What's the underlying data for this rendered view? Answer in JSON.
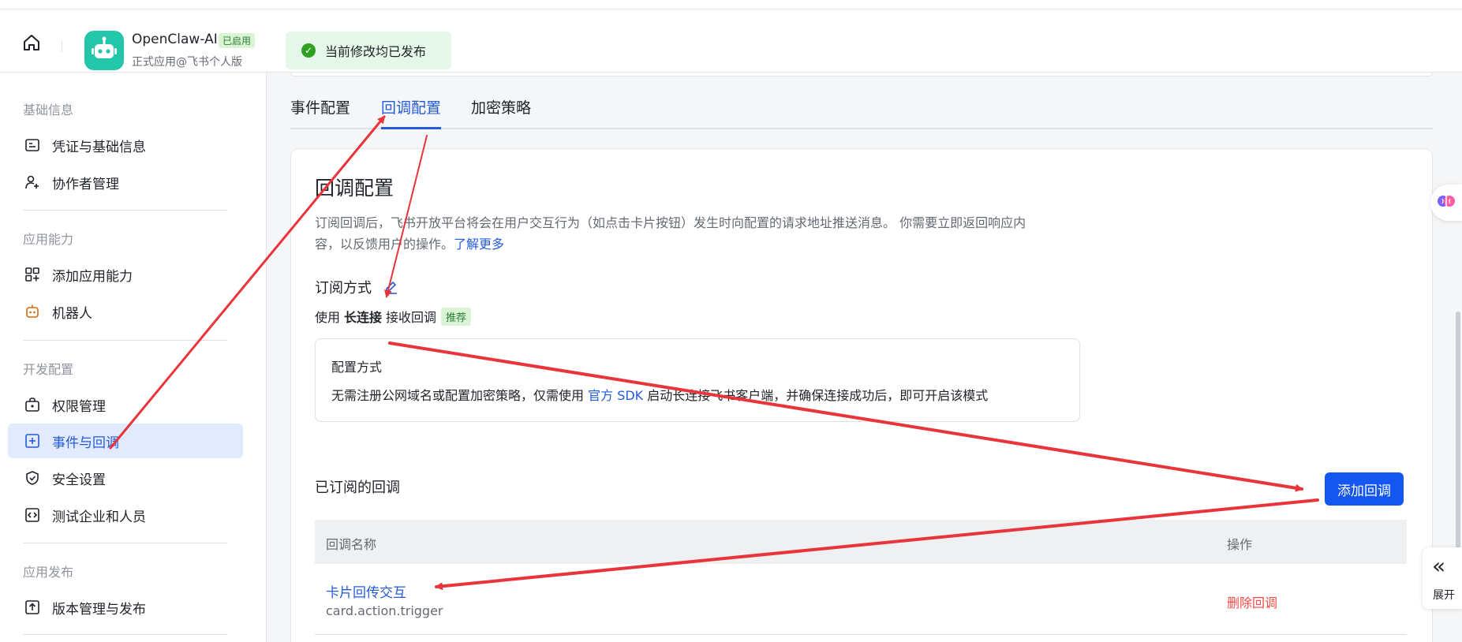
{
  "header": {
    "app_name": "OpenClaw-AI",
    "app_badge": "已启用",
    "app_sub": "正式应用@飞书个人版",
    "publish_status": "当前修改均已发布"
  },
  "sidebar": {
    "sections": [
      {
        "title": "基础信息",
        "items": [
          {
            "label": "凭证与基础信息",
            "icon": "credential-icon"
          },
          {
            "label": "协作者管理",
            "icon": "user-add-icon"
          }
        ]
      },
      {
        "title": "应用能力",
        "items": [
          {
            "label": "添加应用能力",
            "icon": "apps-add-icon"
          },
          {
            "label": "机器人",
            "icon": "robot-icon"
          }
        ]
      },
      {
        "title": "开发配置",
        "items": [
          {
            "label": "权限管理",
            "icon": "lock-bag-icon"
          },
          {
            "label": "事件与回调",
            "icon": "event-icon"
          },
          {
            "label": "安全设置",
            "icon": "shield-icon"
          },
          {
            "label": "测试企业和人员",
            "icon": "code-icon"
          }
        ]
      },
      {
        "title": "应用发布",
        "items": [
          {
            "label": "版本管理与发布",
            "icon": "upload-icon"
          }
        ]
      }
    ],
    "active": "事件与回调"
  },
  "tabs": [
    {
      "label": "事件配置"
    },
    {
      "label": "回调配置"
    },
    {
      "label": "加密策略"
    }
  ],
  "active_tab": "回调配置",
  "card": {
    "title": "回调配置",
    "desc_line1": "订阅回调后，飞书开放平台将会在用户交互行为（如点击卡片按钮）发生时向配置的请求地址推送消息。 你需要立即返回响应内",
    "desc_line2": "容，以反馈用户的操作。",
    "learn_more": "了解更多",
    "subscribe_label": "订阅方式",
    "use_prefix": "使用",
    "use_bold": "长连接",
    "use_suffix": "接收回调",
    "recommend": "推荐",
    "config_title": "配置方式",
    "config_text_1": "无需注册公网域名或配置加密策略，仅需使用",
    "config_link": "官方 SDK",
    "config_text_2": "启动长连接飞书客户端，并确保连接成功后，即可开启该模式"
  },
  "subscribed": {
    "title": "已订阅的回调",
    "add_button": "添加回调",
    "columns": [
      "回调名称",
      "操作"
    ],
    "rows": [
      {
        "name": "卡片回传交互",
        "code": "card.action.trigger",
        "action": "删除回调"
      }
    ]
  },
  "float": {
    "expand": "展开",
    "expand_arrow": "«"
  },
  "colors": {
    "accent": "#245bdb",
    "primary_button": "#1456f0",
    "danger": "#f54a45",
    "annotation_arrow": "#e8343a"
  }
}
